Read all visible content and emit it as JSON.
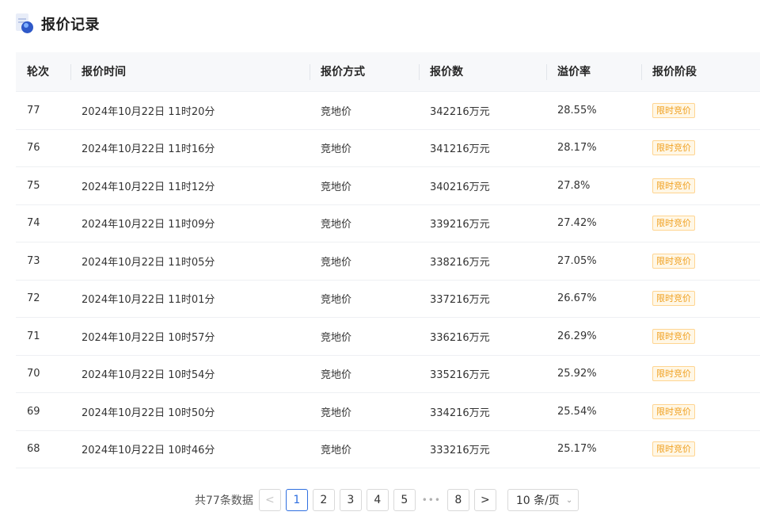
{
  "header": {
    "title": "报价记录",
    "icon": "document-icon"
  },
  "table": {
    "columns": [
      "轮次",
      "报价时间",
      "报价方式",
      "报价数",
      "溢价率",
      "报价阶段"
    ],
    "rows": [
      {
        "round": "77",
        "time": "2024年10月22日 11时20分",
        "method": "竞地价",
        "amount": "342216万元",
        "premium": "28.55%",
        "stage": "限时竞价"
      },
      {
        "round": "76",
        "time": "2024年10月22日 11时16分",
        "method": "竞地价",
        "amount": "341216万元",
        "premium": "28.17%",
        "stage": "限时竞价"
      },
      {
        "round": "75",
        "time": "2024年10月22日 11时12分",
        "method": "竞地价",
        "amount": "340216万元",
        "premium": "27.8%",
        "stage": "限时竞价"
      },
      {
        "round": "74",
        "time": "2024年10月22日 11时09分",
        "method": "竞地价",
        "amount": "339216万元",
        "premium": "27.42%",
        "stage": "限时竞价"
      },
      {
        "round": "73",
        "time": "2024年10月22日 11时05分",
        "method": "竞地价",
        "amount": "338216万元",
        "premium": "27.05%",
        "stage": "限时竞价"
      },
      {
        "round": "72",
        "time": "2024年10月22日 11时01分",
        "method": "竞地价",
        "amount": "337216万元",
        "premium": "26.67%",
        "stage": "限时竞价"
      },
      {
        "round": "71",
        "time": "2024年10月22日 10时57分",
        "method": "竞地价",
        "amount": "336216万元",
        "premium": "26.29%",
        "stage": "限时竞价"
      },
      {
        "round": "70",
        "time": "2024年10月22日 10时54分",
        "method": "竞地价",
        "amount": "335216万元",
        "premium": "25.92%",
        "stage": "限时竞价"
      },
      {
        "round": "69",
        "time": "2024年10月22日 10时50分",
        "method": "竞地价",
        "amount": "334216万元",
        "premium": "25.54%",
        "stage": "限时竞价"
      },
      {
        "round": "68",
        "time": "2024年10月22日 10时46分",
        "method": "竞地价",
        "amount": "333216万元",
        "premium": "25.17%",
        "stage": "限时竞价"
      }
    ]
  },
  "pagination": {
    "total_text": "共77条数据",
    "prev_label": "<",
    "next_label": ">",
    "pages": [
      "1",
      "2",
      "3",
      "4",
      "5"
    ],
    "ellipsis": "•••",
    "last_page": "8",
    "current_page": "1",
    "page_size": "10 条/页",
    "page_size_icon": "chevron-down-icon"
  },
  "colors": {
    "accent": "#2f6fe0",
    "tag_text": "#f0a020",
    "tag_bg": "#fff7e6",
    "tag_border": "#ffd591"
  }
}
